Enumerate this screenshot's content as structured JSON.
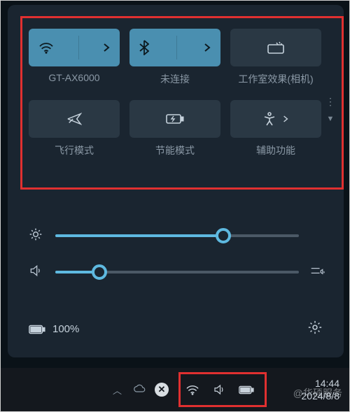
{
  "tiles": [
    {
      "label": "GT-AX6000"
    },
    {
      "label": "未连接"
    },
    {
      "label": "工作室效果(相机)"
    },
    {
      "label": "飞行模式"
    },
    {
      "label": "节能模式"
    },
    {
      "label": "辅助功能"
    }
  ],
  "sliders": {
    "brightness": 69,
    "volume": 18
  },
  "battery": {
    "percent": "100%"
  },
  "clock": {
    "time": "14:44",
    "date": "2024/8/8"
  },
  "watermark": "@华硕服务"
}
